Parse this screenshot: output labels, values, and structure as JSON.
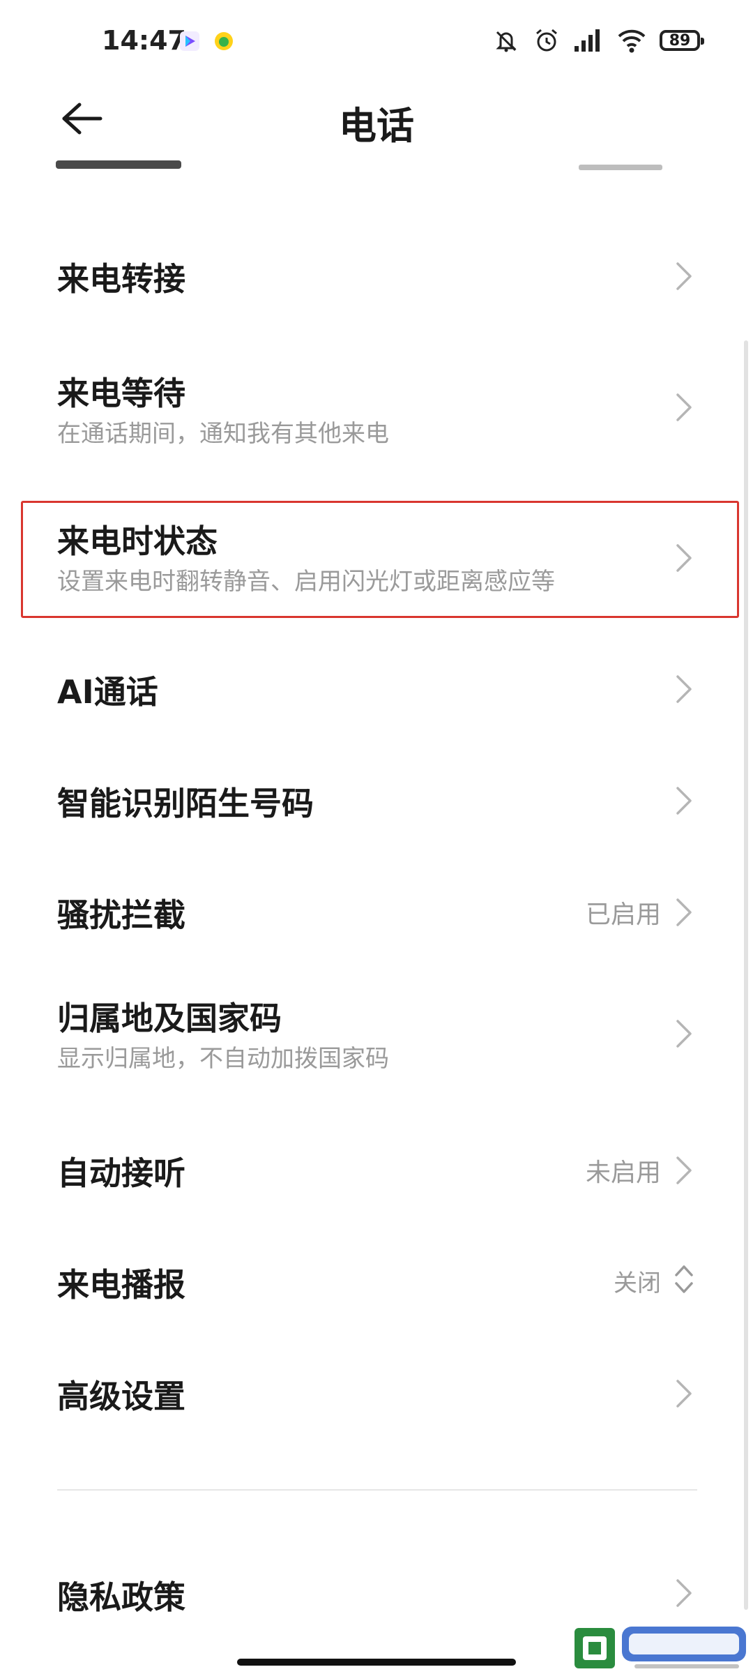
{
  "status": {
    "time": "14:47",
    "battery": "89"
  },
  "header": {
    "title": "电话"
  },
  "rows": [
    {
      "label": "来电转接",
      "sub": "",
      "value": ""
    },
    {
      "label": "来电等待",
      "sub": "在通话期间，通知我有其他来电",
      "value": ""
    },
    {
      "label": "来电时状态",
      "sub": "设置来电时翻转静音、启用闪光灯或距离感应等",
      "value": ""
    },
    {
      "label": "AI通话",
      "sub": "",
      "value": ""
    },
    {
      "label": "智能识别陌生号码",
      "sub": "",
      "value": ""
    },
    {
      "label": "骚扰拦截",
      "sub": "",
      "value": "已启用"
    },
    {
      "label": "归属地及国家码",
      "sub": "显示归属地，不自动加拨国家码",
      "value": ""
    },
    {
      "label": "自动接听",
      "sub": "",
      "value": "未启用"
    },
    {
      "label": "来电播报",
      "sub": "",
      "value": "关闭"
    },
    {
      "label": "高级设置",
      "sub": "",
      "value": ""
    }
  ],
  "footer": {
    "privacy_label": "隐私政策"
  },
  "colors": {
    "highlight": "#d9362f",
    "text": "#1a1a1a",
    "secondary": "#9a9a9a"
  },
  "icons": [
    "back-arrow-icon",
    "chevron-right-icon",
    "chevron-up-down-icon",
    "mute-icon",
    "alarm-icon",
    "signal-icon",
    "wifi-icon",
    "battery-icon"
  ]
}
